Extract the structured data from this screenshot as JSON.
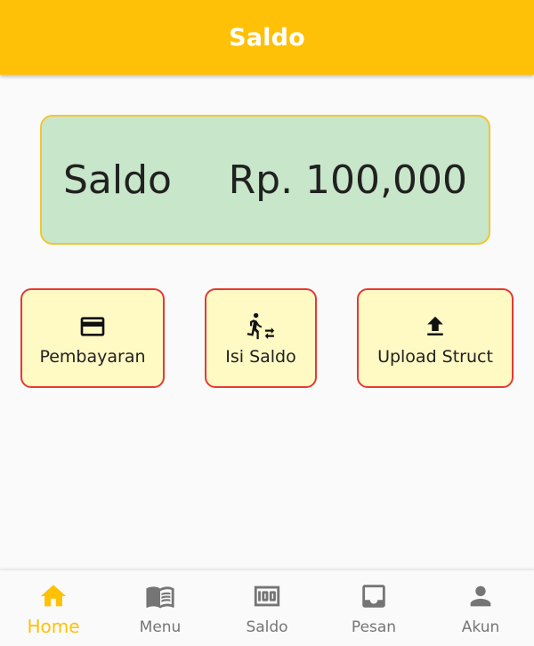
{
  "appbar": {
    "title": "Saldo"
  },
  "balance": {
    "label": "Saldo",
    "amount": "Rp. 100,000"
  },
  "actions": [
    {
      "label": "Pembayaran",
      "icon": "credit-card-icon"
    },
    {
      "label": "Isi Saldo",
      "icon": "transfer-walk-icon"
    },
    {
      "label": "Upload Struct",
      "icon": "upload-icon"
    }
  ],
  "bottom_nav": {
    "active_color": "#ffc107",
    "inactive_color": "#757575",
    "items": [
      {
        "label": "Home",
        "icon": "home-icon",
        "active": true
      },
      {
        "label": "Menu",
        "icon": "menu-book-icon",
        "active": false
      },
      {
        "label": "Saldo",
        "icon": "money-100-icon",
        "active": false
      },
      {
        "label": "Pesan",
        "icon": "inbox-icon",
        "active": false
      },
      {
        "label": "Akun",
        "icon": "person-icon",
        "active": false
      }
    ]
  }
}
